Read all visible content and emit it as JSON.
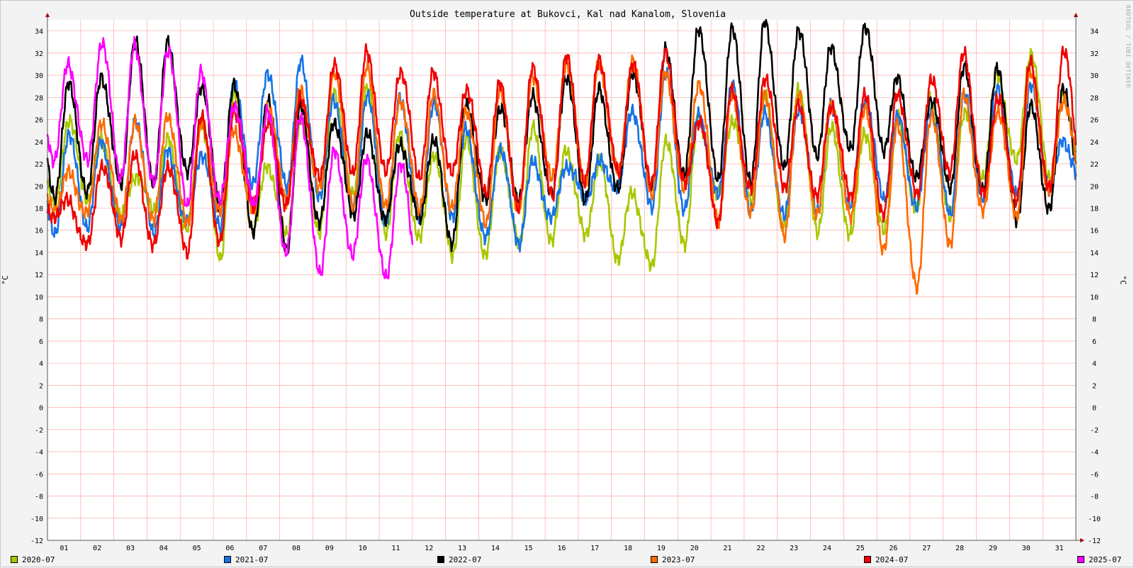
{
  "chart_data": {
    "type": "line",
    "title": "Outside temperature at Bukovci, Kal nad Kanalom, Slovenia",
    "ylabel": "°C",
    "xlabel": "",
    "ylim": [
      -12,
      35
    ],
    "y_ticks": [
      -12,
      -10,
      -8,
      -6,
      -4,
      -2,
      0,
      2,
      4,
      6,
      8,
      10,
      12,
      14,
      16,
      18,
      20,
      22,
      24,
      26,
      28,
      30,
      32,
      34
    ],
    "y_tick_labels": [
      "-12",
      "-10",
      "-8",
      "-6",
      "-4",
      "-2",
      "0",
      "2",
      "4",
      "6",
      "8",
      "10",
      "12",
      "14",
      "16",
      "18",
      "20",
      "22",
      "24",
      "26",
      "28",
      "30",
      "32",
      "34"
    ],
    "x_labels": [
      "01",
      "02",
      "03",
      "04",
      "05",
      "06",
      "07",
      "08",
      "09",
      "10",
      "11",
      "12",
      "13",
      "14",
      "15",
      "16",
      "17",
      "18",
      "19",
      "20",
      "21",
      "22",
      "23",
      "24",
      "25",
      "26",
      "27",
      "28",
      "29",
      "30",
      "31"
    ],
    "grid": true,
    "legend_position": "bottom",
    "series": [
      {
        "name": "2020-07",
        "color": "#a8c800",
        "min": [
          18,
          19,
          17,
          18,
          16,
          13.5,
          16,
          15.5,
          16,
          19,
          16,
          15,
          14,
          13.5,
          15,
          15,
          15.5,
          13.5,
          12.5,
          15,
          19,
          19,
          16,
          16,
          15.5,
          16,
          18,
          17,
          21,
          22,
          21
        ],
        "max": [
          26,
          24,
          21,
          24,
          26,
          28,
          22,
          26,
          28.5,
          29,
          24.5,
          23,
          24,
          23.5,
          25,
          23.5,
          22,
          19.5,
          24,
          26,
          26,
          28,
          29,
          25,
          25,
          26,
          28,
          26.5,
          30,
          32,
          28
        ]
      },
      {
        "name": "2021-07",
        "color": "#1673e6",
        "min": [
          15.5,
          16.5,
          16,
          16,
          16.5,
          16.5,
          20,
          20,
          19,
          18,
          17,
          17,
          17.5,
          15,
          15,
          17,
          19,
          20,
          18,
          18,
          19,
          18,
          17,
          18,
          18,
          19,
          18,
          17.5,
          19,
          19,
          20
        ],
        "max": [
          24.5,
          24,
          26,
          23,
          23,
          29,
          30.5,
          31,
          28,
          28,
          28,
          27.5,
          25,
          23.5,
          22,
          22,
          22,
          27,
          30,
          26.5,
          29,
          26.5,
          27,
          27,
          28,
          26,
          27,
          28,
          29,
          29,
          24
        ]
      },
      {
        "name": "2022-07",
        "color": "#000000",
        "min": [
          19,
          19.5,
          20,
          20.5,
          21,
          18.5,
          15.5,
          14.5,
          16.5,
          17.5,
          17,
          17,
          15,
          18.5,
          19,
          19,
          19,
          19.5,
          20,
          21,
          20.5,
          20.5,
          21.5,
          23,
          23,
          23.5,
          20.5,
          20,
          19.5,
          17,
          18
        ],
        "max": [
          29,
          30,
          33,
          33,
          29,
          29,
          28,
          27,
          26,
          24.5,
          24,
          24,
          27.5,
          27,
          28,
          30,
          28.5,
          30.5,
          32,
          34.5,
          34,
          35,
          34,
          32.5,
          34.5,
          29.5,
          28,
          30.5,
          31,
          27,
          29
        ]
      },
      {
        "name": "2023-07",
        "color": "#ff6a00",
        "min": [
          18,
          17.5,
          17,
          17,
          16.5,
          18,
          17.5,
          19,
          19.5,
          18.5,
          18,
          18,
          18,
          16.5,
          18,
          20.5,
          20.5,
          21,
          19.5,
          19.5,
          17,
          17.5,
          15.5,
          17.5,
          17,
          14.5,
          10.5,
          15,
          17.5,
          17.5,
          19.5
        ],
        "max": [
          21,
          26,
          25.5,
          26.5,
          25.5,
          25,
          27,
          28.5,
          30.5,
          30.5,
          28,
          28,
          27,
          28.5,
          30,
          31,
          31,
          31.5,
          30,
          29.5,
          28,
          28.5,
          28,
          27.5,
          27,
          25.5,
          26.5,
          28,
          27,
          30,
          28
        ]
      },
      {
        "name": "2024-07",
        "color": "#f00000",
        "min": [
          17.5,
          14.5,
          15.5,
          14.5,
          14,
          15,
          18,
          18.5,
          20.5,
          21.5,
          21,
          21,
          21,
          19.5,
          18,
          19,
          20.5,
          21,
          20.5,
          20,
          17,
          19.5,
          20,
          19,
          19,
          17.5,
          19,
          21.5,
          19,
          19,
          19.5
        ],
        "max": [
          18.5,
          22,
          22.5,
          22,
          26,
          27,
          25.5,
          28,
          31,
          32,
          30.5,
          30,
          29,
          29,
          31,
          31.5,
          31.5,
          31,
          32,
          26,
          28.5,
          30,
          27,
          27.5,
          28,
          28.5,
          29.5,
          32,
          28,
          31,
          32.5
        ]
      },
      {
        "name": "2025-07",
        "color": "#ff00ff",
        "min": [
          22.5,
          22,
          21,
          20,
          18.5,
          18.5,
          18.5,
          14,
          12,
          14,
          11.5
        ],
        "max": [
          31,
          33,
          32.5,
          32.5,
          30,
          27.5,
          26.5,
          26.5,
          23,
          22.5,
          22
        ]
      }
    ]
  },
  "watermark": "RRDTOOL / TOBI OETIKER"
}
